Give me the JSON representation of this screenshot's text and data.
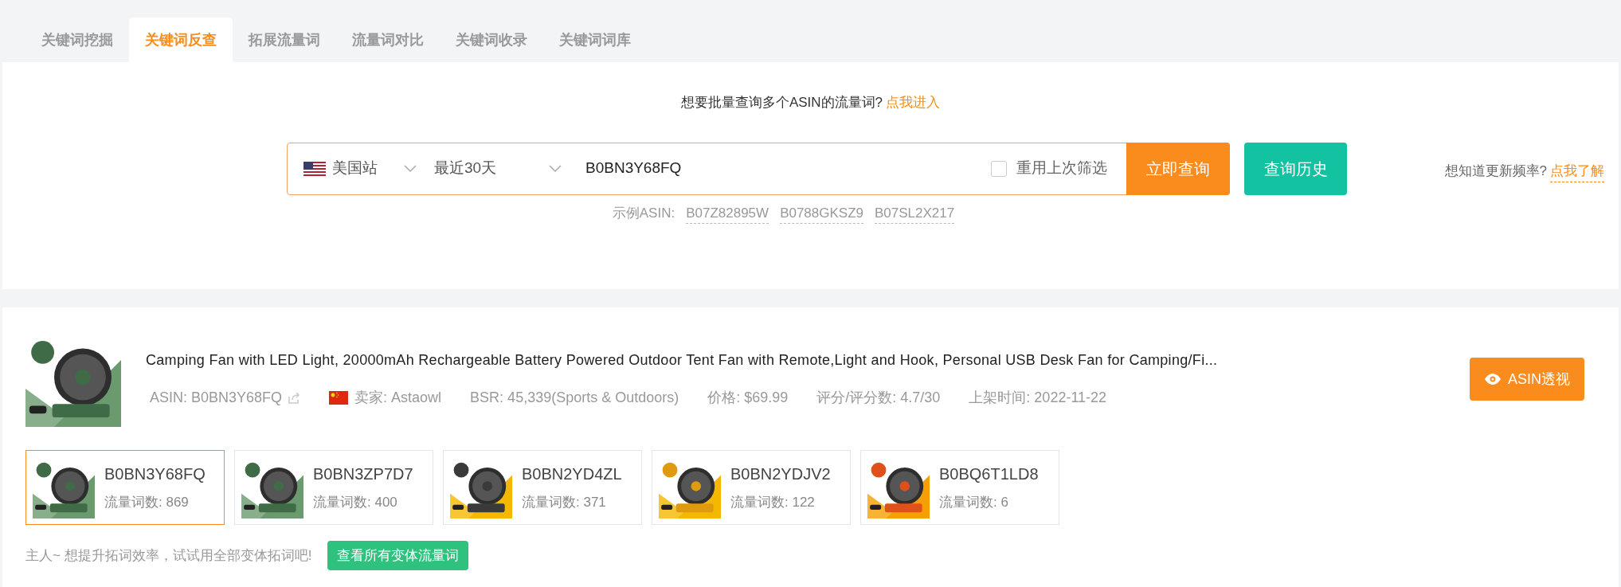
{
  "tabs": [
    {
      "label": "关键词挖掘",
      "selected": false
    },
    {
      "label": "关键词反查",
      "selected": true
    },
    {
      "label": "拓展流量词",
      "selected": false
    },
    {
      "label": "流量词对比",
      "selected": false
    },
    {
      "label": "关键词收录",
      "selected": false
    },
    {
      "label": "关键词词库",
      "selected": false
    }
  ],
  "banner": {
    "text": "想要批量查询多个ASIN的流量词?",
    "link": "点我进入"
  },
  "search": {
    "site": "美国站",
    "period": "最近30天",
    "value": "B0BN3Y68FQ",
    "reuse_filter": {
      "label": "重用上次筛选",
      "checked": false
    },
    "submit": "立即查询",
    "history": "查询历史"
  },
  "update_hint": {
    "text": "想知道更新频率?",
    "link": "点我了解"
  },
  "examples": {
    "label": "示例ASIN:",
    "asins": [
      "B07Z82895W",
      "B0788GKSZ9",
      "B07SL2X217"
    ]
  },
  "product": {
    "title": "Camping Fan with LED Light, 20000mAh Rechargeable Battery Powered Outdoor Tent Fan with Remote,Light and Hook, Personal USB Desk Fan for Camping/Fi...",
    "asin": "ASIN: B0BN3Y68FQ",
    "seller": "卖家: Astaowl",
    "bsr": "BSR: 45,339(Sports & Outdoors)",
    "price": "价格: $69.99",
    "rating": "评分/评分数: 4.7/30",
    "listed": "上架时间: 2022-11-22",
    "action": "ASIN透视"
  },
  "variants": [
    {
      "asin": "B0BN3Y68FQ",
      "count": "流量词数: 869",
      "selected": true
    },
    {
      "asin": "B0BN3ZP7D7",
      "count": "流量词数: 400",
      "selected": false
    },
    {
      "asin": "B0BN2YD4ZL",
      "count": "流量词数: 371",
      "selected": false
    },
    {
      "asin": "B0BN2YDJV2",
      "count": "流量词数: 122",
      "selected": false
    },
    {
      "asin": "B0BQ6T1LD8",
      "count": "流量词数: 6",
      "selected": false
    }
  ],
  "footer": {
    "text": "主人~ 想提升拓词效率，试试用全部变体拓词吧!",
    "button": "查看所有变体流量词"
  }
}
